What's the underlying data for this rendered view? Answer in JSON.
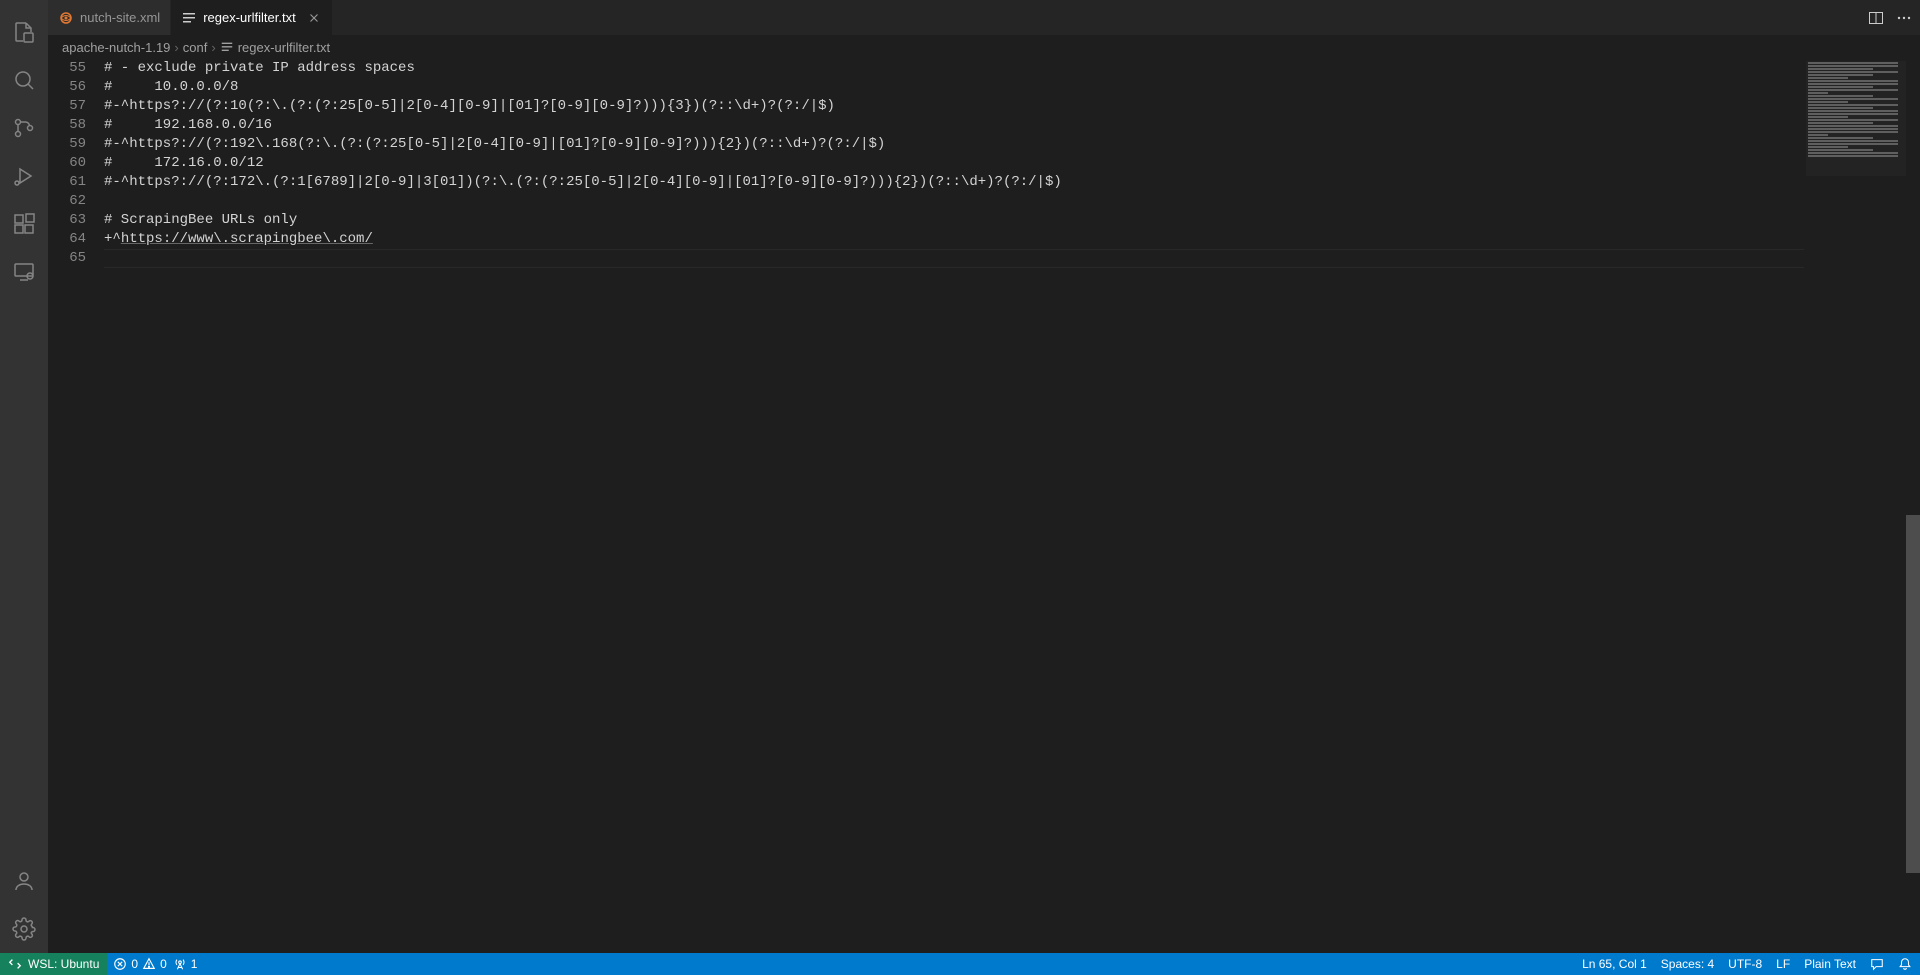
{
  "tabs": [
    {
      "label": "nutch-site.xml",
      "active": false,
      "icon": "xml-icon"
    },
    {
      "label": "regex-urlfilter.txt",
      "active": true,
      "icon": "text-icon"
    }
  ],
  "breadcrumbs": {
    "parts": [
      "apache-nutch-1.19",
      "conf",
      "regex-urlfilter.txt"
    ]
  },
  "lines": [
    {
      "num": "55",
      "text": "# - exclude private IP address spaces"
    },
    {
      "num": "56",
      "text": "#     10.0.0.0/8"
    },
    {
      "num": "57",
      "text": "#-^https?://(?:10(?:\\.(?:(?:25[0-5]|2[0-4][0-9]|[01]?[0-9][0-9]?))){3})(?::\\d+)?(?:/|$)"
    },
    {
      "num": "58",
      "text": "#     192.168.0.0/16"
    },
    {
      "num": "59",
      "text": "#-^https?://(?:192\\.168(?:\\.(?:(?:25[0-5]|2[0-4][0-9]|[01]?[0-9][0-9]?))){2})(?::\\d+)?(?:/|$)"
    },
    {
      "num": "60",
      "text": "#     172.16.0.0/12"
    },
    {
      "num": "61",
      "text": "#-^https?://(?:172\\.(?:1[6789]|2[0-9]|3[01])(?:\\.(?:(?:25[0-5]|2[0-4][0-9]|[01]?[0-9][0-9]?))){2})(?::\\d+)?(?:/|$)"
    },
    {
      "num": "62",
      "text": ""
    },
    {
      "num": "63",
      "text": "# ScrapingBee URLs only"
    },
    {
      "num": "64",
      "prefix": "+^",
      "link": "https://www\\.scrapingbee\\.com/",
      "suffix": ""
    },
    {
      "num": "65",
      "text": "",
      "current": true
    }
  ],
  "status": {
    "remote": "WSL: Ubuntu",
    "errors": "0",
    "warnings": "0",
    "ports": "1",
    "cursor": "Ln 65, Col 1",
    "spaces": "Spaces: 4",
    "encoding": "UTF-8",
    "eol": "LF",
    "language": "Plain Text"
  }
}
